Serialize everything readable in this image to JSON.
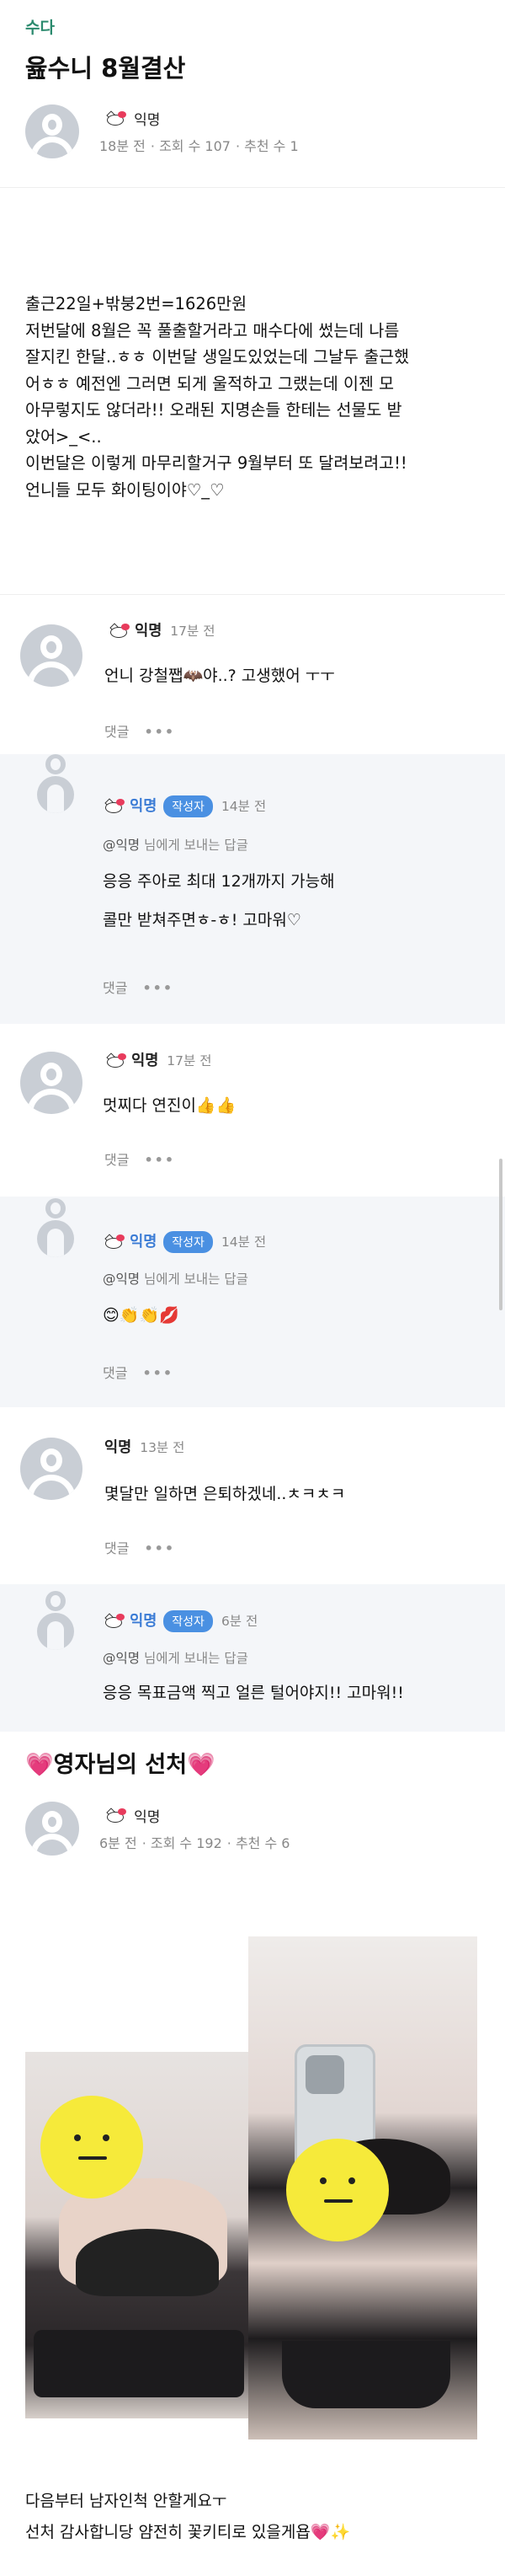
{
  "post": {
    "category": "수다",
    "title": "윮수니 8월결산",
    "author": {
      "icon": "hello-kitty-icon",
      "nickname": "익명"
    },
    "meta": {
      "time": "18분 전",
      "views": "조회 수 107",
      "likes": "추천 수 1"
    },
    "body": [
      "출근22일+밖붕2번=1626만원",
      "저번달에 8월은 꼭 풀출할거라고 매수다에 썼는데 나름",
      "잘지킨 한달..ㅎㅎ 이번달 생일도있었는데 그날두 출근했",
      "어ㅎㅎ 예전엔 그러면 되게 울적하고 그랬는데 이젠 모",
      "아무렇지도 않더라!! 오래된 지명손들 한테는 선물도 받",
      "았어>_<..",
      "이번달은 이렇게 마무리할거구 9월부터 또 달려보려고!!",
      "언니들 모두 화이팅이야♡_♡"
    ]
  },
  "comments": [
    {
      "nick": "익명",
      "time": "17분 전",
      "text": "언니 강철쨉🦇야..? 고생했어 ㅜㅜ",
      "reply_label": "댓글",
      "more": "•••"
    },
    {
      "nick": "익명",
      "badge": "작성자",
      "time": "14분 전",
      "to_user": "@익명",
      "to_suffix": " 님에게 보내는 답글",
      "lines": [
        "응응 주아로 최대 12개까지 가능해",
        "콜만 받쳐주면ㅎ-ㅎ! 고마워♡"
      ],
      "reply_label": "댓글",
      "more": "•••"
    },
    {
      "nick": "익명",
      "time": "17분 전",
      "text": "멋찌다 연진이👍👍",
      "reply_label": "댓글",
      "more": "•••"
    },
    {
      "nick": "익명",
      "badge": "작성자",
      "time": "14분 전",
      "to_user": "@익명",
      "to_suffix": " 님에게 보내는 답글",
      "text": "😊👏👏💋",
      "reply_label": "댓글",
      "more": "•••"
    },
    {
      "nick": "익명",
      "time": "13분 전",
      "text": "몇달만 일하면 은퇴하겠네..ㅊㅋㅊㅋ",
      "reply_label": "댓글",
      "more": "•••"
    },
    {
      "nick": "익명",
      "badge": "작성자",
      "time": "6분 전",
      "to_user": "@익명",
      "to_suffix": " 님에게 보내는 답글",
      "text": "응응 목표금액 찍고 얼른 털어야지!! 고마워!!"
    }
  ],
  "next_post": {
    "title": "💗영자님의 선처💗",
    "author": {
      "icon": "hello-kitty-icon",
      "nickname": "익명"
    },
    "meta": {
      "time": "6분 전",
      "views": "조회 수 192",
      "likes": "추천 수 6"
    },
    "lines": [
      "다음부터 남자인척 안할게요ㅜ",
      "선처 감사합니당 얌전히 꽃키티로 있을게욥💗✨"
    ]
  }
}
